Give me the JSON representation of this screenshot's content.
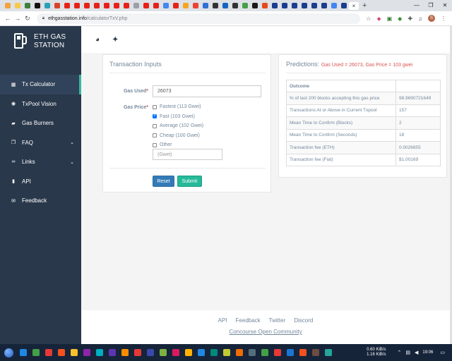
{
  "browser": {
    "tab_colors": [
      "#f2a33c",
      "#f7c948",
      "#3e7f3e",
      "#111111",
      "#27a0b8",
      "#d8442a",
      "#e62117",
      "#e62117",
      "#e62117",
      "#e62117",
      "#e62117",
      "#e62117",
      "#e62117",
      "#9aa0a6",
      "#e62117",
      "#e62117",
      "#4285f4",
      "#e62117",
      "#f4a623",
      "#ea4335",
      "#2f6fd6",
      "#333333",
      "#1565c0",
      "#333333",
      "#43a047",
      "#1a1a1a",
      "#e64a19",
      "#1a3d8f",
      "#1a3d8f",
      "#1a3d8f",
      "#1a3d8f",
      "#1a3d8f",
      "#1a3d8f",
      "#4285f4",
      "#1a3d8f"
    ],
    "active_tab_close": "×",
    "new_tab": "+",
    "url_host": "ethgasstation.info",
    "url_path": "/calculatorTxV.php",
    "profile_initial": "S"
  },
  "sidebar": {
    "brand_line1": "ETH GAS",
    "brand_line2": "STATION",
    "items": [
      {
        "label": "Tx Calculator",
        "icon": "calculator-icon",
        "glyph": "▦",
        "active": true,
        "expandable": false
      },
      {
        "label": "TxPool Vision",
        "icon": "eye-icon",
        "glyph": "◉",
        "active": false,
        "expandable": false
      },
      {
        "label": "Gas Burners",
        "icon": "car-icon",
        "glyph": "▰",
        "active": false,
        "expandable": false
      },
      {
        "label": "FAQ",
        "icon": "bookmark-icon",
        "glyph": "❐",
        "active": false,
        "expandable": true
      },
      {
        "label": "Links",
        "icon": "link-icon",
        "glyph": "∞",
        "active": false,
        "expandable": true
      },
      {
        "label": "API",
        "icon": "book-icon",
        "glyph": "▮",
        "active": false,
        "expandable": false
      },
      {
        "label": "Feedback",
        "icon": "envelope-icon",
        "glyph": "✉",
        "active": false,
        "expandable": false
      }
    ],
    "chevron": "⌄"
  },
  "header": {
    "discord_glyph": "◕",
    "twitter_glyph": "✦"
  },
  "inputs": {
    "title": "Transaction Inputs",
    "gas_used_label": "Gas Used",
    "gas_used_value": "26073",
    "gas_price_label": "Gas Price",
    "required_mark": "*",
    "options": [
      {
        "label": "Fastest (113 Gwei)",
        "checked": false
      },
      {
        "label": "Fast (103 Gwei)",
        "checked": true
      },
      {
        "label": "Average (102 Gwei)",
        "checked": false
      },
      {
        "label": "Cheap (100 Gwei)",
        "checked": false
      },
      {
        "label": "Other",
        "checked": false
      }
    ],
    "other_placeholder": "(Gwei)",
    "reset_label": "Reset",
    "submit_label": "Submit"
  },
  "predictions": {
    "title": "Predictions:",
    "highlight": "Gas Used = 26073, Gas Price = 103 gwei",
    "header": "Outcome",
    "rows": [
      {
        "label": "% of last 200 blocks accepting this gas price",
        "value": "98.9690721649"
      },
      {
        "label": "Transactions At or Above in Current Txpool",
        "value": "157"
      },
      {
        "label": "Mean Time to Confirm (Blocks)",
        "value": "2"
      },
      {
        "label": "Mean Time to Confirm (Seconds)",
        "value": "18"
      },
      {
        "label": "Transaction fee (ETH)",
        "value": "0.0026855"
      },
      {
        "label": "Transaction fee (Fiat)",
        "value": "$1.00169"
      }
    ]
  },
  "footer": {
    "links": [
      "API",
      "Feedback",
      "Twitter",
      "Discord"
    ],
    "community": "Concourse Open Community"
  },
  "taskbar": {
    "app_colors": [
      "#1e88e5",
      "#43a047",
      "#e53935",
      "#f4511e",
      "#fbc02d",
      "#8e24aa",
      "#00acc1",
      "#5e35b1",
      "#fb8c00",
      "#e53935",
      "#3949ab",
      "#7cb342",
      "#d81b60",
      "#ffb300",
      "#1e88e5",
      "#00897b",
      "#c0ca33",
      "#ef6c00",
      "#546e7a",
      "#43a047",
      "#e53935",
      "#1976d2",
      "#f4511e",
      "#6d4c41",
      "#26a69a"
    ],
    "net_up": "0.60 KiB/s",
    "net_down": "1.16 KiB/s",
    "time": "19:06"
  }
}
